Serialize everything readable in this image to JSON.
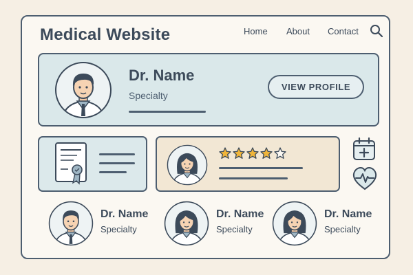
{
  "header": {
    "title": "Medical Website",
    "nav": [
      "Home",
      "About",
      "Contact"
    ]
  },
  "featured": {
    "name": "Dr. Name",
    "specialty": "Specialty",
    "button_label": "VIEW PROFILE"
  },
  "review": {
    "rating": 4,
    "max_rating": 5
  },
  "doctors": [
    {
      "name": "Dr. Name",
      "specialty": "Specialty"
    },
    {
      "name": "Dr. Name",
      "specialty": "Specialty"
    },
    {
      "name": "Dr. Name",
      "specialty": "Specialty"
    }
  ],
  "colors": {
    "background": "#f6efe4",
    "ink": "#3c4a5a",
    "card_blue": "#dae8ea",
    "card_beige": "#f2e7d4",
    "star": "#f0b53a"
  },
  "icons": [
    "search-icon",
    "certificate-icon",
    "calendar-plus-icon",
    "heart-pulse-icon"
  ]
}
